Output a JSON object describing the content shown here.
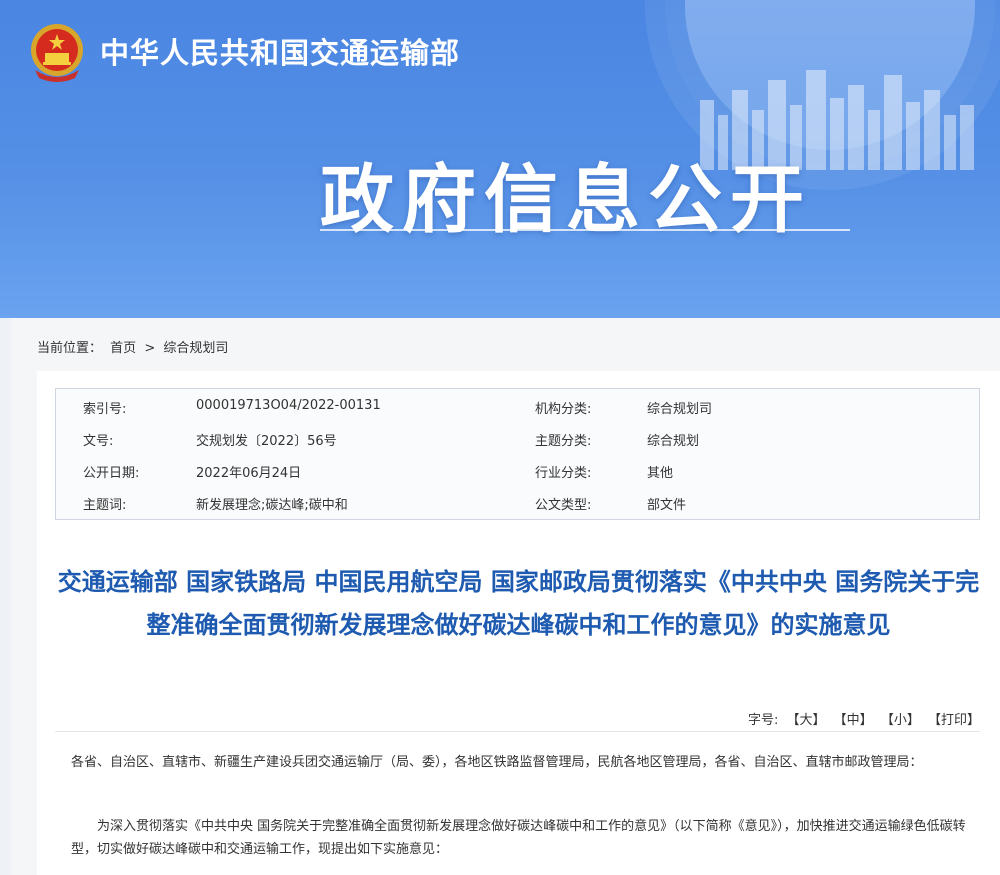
{
  "header": {
    "ministry_name": "中华人民共和国交通运输部",
    "section_title": "政府信息公开"
  },
  "breadcrumb": {
    "label": "当前位置：",
    "home": "首页",
    "separator": ">",
    "current": "综合规划司"
  },
  "info": {
    "rows": [
      {
        "k1": "索引号:",
        "v1": "000019713O04/2022-00131",
        "k2": "机构分类:",
        "v2": "综合规划司"
      },
      {
        "k1": "文号:",
        "v1": "交规划发〔2022〕56号",
        "k2": "主题分类:",
        "v2": "综合规划"
      },
      {
        "k1": "公开日期:",
        "v1": "2022年06月24日",
        "k2": "行业分类:",
        "v2": "其他"
      },
      {
        "k1": "主题词:",
        "v1": "新发展理念;碳达峰;碳中和",
        "k2": "公文类型:",
        "v2": "部文件"
      }
    ]
  },
  "document": {
    "title": "交通运输部 国家铁路局 中国民用航空局 国家邮政局贯彻落实《中共中央 国务院关于完整准确全面贯彻新发展理念做好碳达峰碳中和工作的意见》的实施意见",
    "font_size_label": "字号:",
    "font_large": "【大】",
    "font_medium": "【中】",
    "font_small": "【小】",
    "print": "【打印】",
    "para1": "各省、自治区、直辖市、新疆生产建设兵团交通运输厅（局、委），各地区铁路监督管理局，民航各地区管理局，各省、自治区、直辖市邮政管理局：",
    "para2": "为深入贯彻落实《中共中央 国务院关于完整准确全面贯彻新发展理念做好碳达峰碳中和工作的意见》（以下简称《意见》），加快推进交通运输绿色低碳转型，切实做好碳达峰碳中和交通运输工作，现提出如下实施意见："
  },
  "colors": {
    "banner": "#4a86e2",
    "title": "#1e5bb0"
  }
}
